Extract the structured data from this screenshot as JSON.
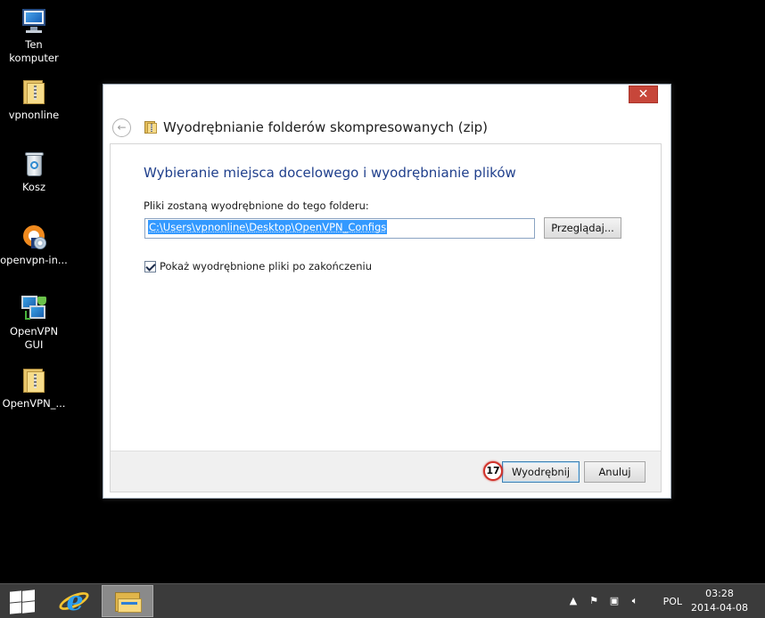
{
  "desktop": {
    "icons": [
      {
        "label": "Ten komputer",
        "icon": "computer-icon"
      },
      {
        "label": "vpnonline",
        "icon": "zip-folder-icon"
      },
      {
        "label": "Kosz",
        "icon": "recycle-bin-icon"
      },
      {
        "label": "openvpn-in...",
        "icon": "openvpn-installer-icon"
      },
      {
        "label": "OpenVPN GUI",
        "icon": "openvpn-gui-icon"
      },
      {
        "label": "OpenVPN_...",
        "icon": "zip-folder-icon"
      }
    ]
  },
  "dialog": {
    "close_label": "✕",
    "title": "Wyodrębnianie folderów skompresowanych (zip)",
    "heading": "Wybieranie miejsca docelowego i wyodrębnianie plików",
    "field_label": "Pliki zostaną wyodrębnione do tego folderu:",
    "path_value": "C:\\Users\\vpnonline\\Desktop\\OpenVPN_Configs",
    "browse_label": "Przeglądaj...",
    "checkbox_label": "Pokaż wyodrębnione pliki po zakończeniu",
    "checkbox_checked": true,
    "extract_label": "Wyodrębnij",
    "cancel_label": "Anuluj",
    "step_badge": "17",
    "accent_color": "#1f3f8c",
    "close_color": "#c7463a"
  },
  "taskbar": {
    "language": "POL",
    "time": "03:28",
    "date": "2014-04-08",
    "tray_icons": [
      "show-hidden-icons-icon",
      "action-center-flag-icon",
      "network-icon",
      "volume-icon"
    ]
  }
}
